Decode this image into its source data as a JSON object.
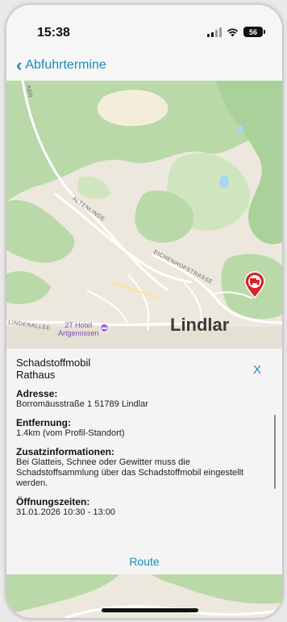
{
  "status_bar": {
    "time": "15:38",
    "battery": "56",
    "icons": [
      "signal-icon",
      "wifi-icon",
      "battery-icon"
    ]
  },
  "nav": {
    "back_label": "Abfuhrtermine",
    "back_icon": "chevron-left-icon"
  },
  "map": {
    "labels": {
      "road_top": "ABR",
      "road1": "ALTENLINDE",
      "road2": "EICHENHOFSTRASSE",
      "road3": "LINDENALLEE",
      "hotel_line1": "2T Hotel",
      "hotel_line2": "Artgenossen",
      "town": "Lindlar"
    },
    "marker_icon": "truck-pin-icon",
    "colors": {
      "forest": "#b9d9a8",
      "land": "#ece8dd",
      "water": "#a8d8ef",
      "pin": "#d8232a"
    }
  },
  "panel": {
    "title_line1": "Schadstoffmobil",
    "title_line2": "Rathaus",
    "close_label": "X",
    "address_heading": "Adresse:",
    "address_value": "Borromäusstraße 1 51789 Lindlar",
    "distance_heading": "Entfernung:",
    "distance_value": "1.4km (vom Profil-Standort)",
    "info_heading": "Zusatzinformationen:",
    "info_value": "Bei Glatteis, Schnee oder Gewitter muss die Schadstoffsammlung über das Schadstoffmobil eingestellt werden.",
    "hours_heading": "Öffnungszeiten:",
    "hours_value": "31.01.2026 10:30 - 13:00",
    "route_label": "Route"
  },
  "colors": {
    "accent": "#1a8db5"
  }
}
